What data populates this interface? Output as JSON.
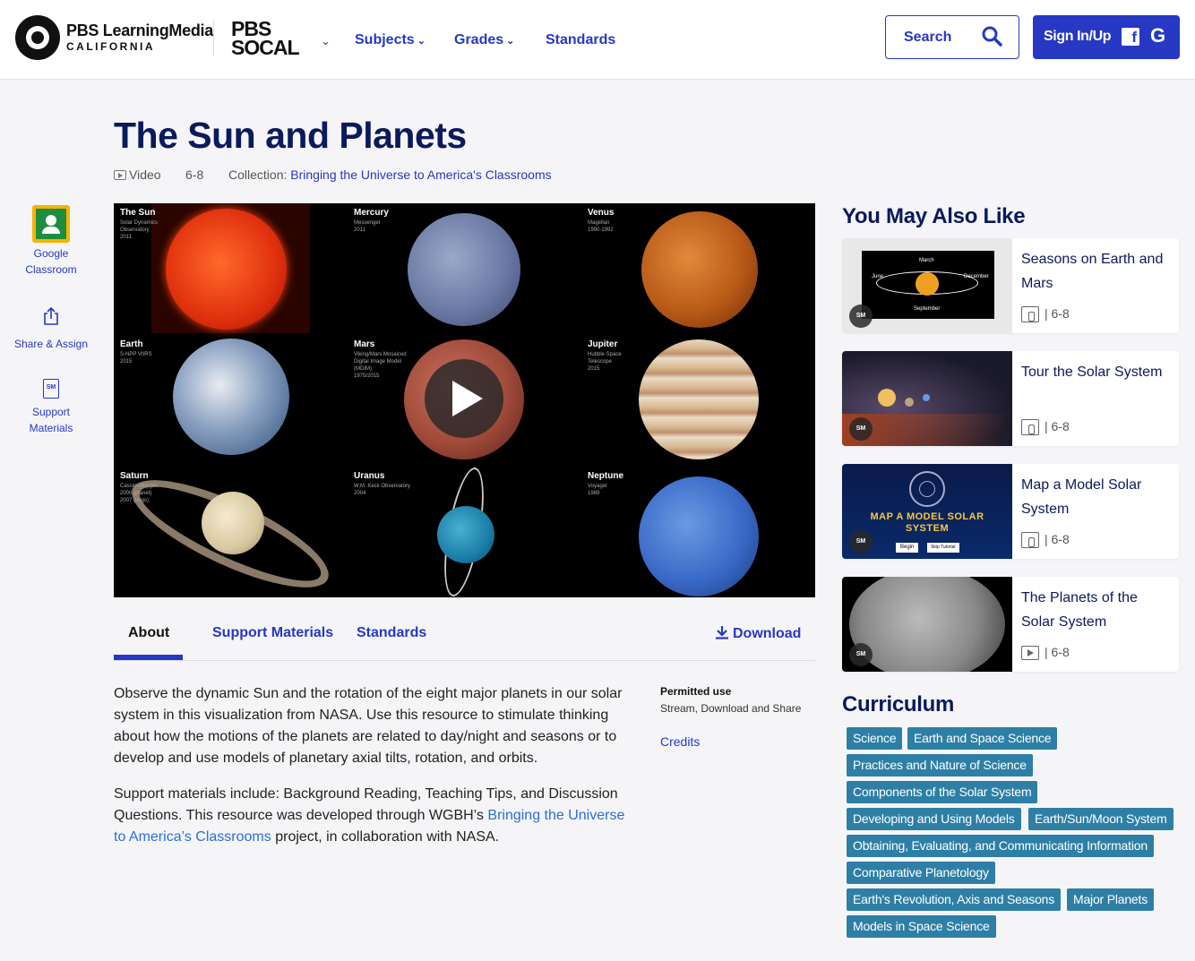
{
  "header": {
    "logo_line1": "PBS LearningMedia",
    "logo_line2": "CALIFORNIA",
    "station": "PBS SOCAL",
    "nav": [
      {
        "label": "Subjects",
        "has_dropdown": true
      },
      {
        "label": "Grades",
        "has_dropdown": true
      },
      {
        "label": "Standards",
        "has_dropdown": false
      }
    ],
    "search_label": "Search",
    "signin_label": "Sign In/Up"
  },
  "page": {
    "title": "The Sun and Planets",
    "media_type": "Video",
    "grades": "6-8",
    "collection_label": "Collection:",
    "collection_name": "Bringing the Universe to America's Classrooms"
  },
  "sidebar": {
    "google_classroom": "Google Classroom",
    "share_assign": "Share & Assign",
    "support_materials": "Support Materials",
    "sm_badge": "SM"
  },
  "video_panels": [
    {
      "name": "The Sun",
      "sub": "Solar Dynamics\nObservatory\n2011"
    },
    {
      "name": "Mercury",
      "sub": "Messenger\n2011"
    },
    {
      "name": "Venus",
      "sub": "Magellan\n1990-1992"
    },
    {
      "name": "Earth",
      "sub": "S-NPP VIIRS\n2015"
    },
    {
      "name": "Mars",
      "sub": "Viking/Mars Mosaiced\nDigital Image Model\n(MDIM)\n1975/2015"
    },
    {
      "name": "Jupiter",
      "sub": "Hubble Space\nTelescope\n2015"
    },
    {
      "name": "Saturn",
      "sub": "Cassini-Huygen\n2000 (planet)\n2007 (rings)"
    },
    {
      "name": "Uranus",
      "sub": "W.M. Keck Observatory\n2004"
    },
    {
      "name": "Neptune",
      "sub": "Voyager\n1989"
    }
  ],
  "tabs": {
    "about": "About",
    "support": "Support Materials",
    "standards": "Standards",
    "download": "Download"
  },
  "about": {
    "p1": "Observe the dynamic Sun and the rotation of the eight major planets in our solar system in this visualization from NASA. Use this resource to stimulate thinking about how the motions of the planets are related to day/night and seasons or to develop and use models of planetary axial tilts, rotation, and orbits.",
    "p2_before": "Support materials include: Background Reading, Teaching Tips, and Discussion Questions. This resource was developed through WGBH’s ",
    "p2_link": "Bringing the Universe to America’s Classrooms",
    "p2_after": " project, in collaboration with NASA.",
    "permitted_heading": "Permitted use",
    "permitted_value": "Stream, Download and Share",
    "credits": "Credits"
  },
  "related": {
    "heading": "You May Also Like",
    "items": [
      {
        "title": "Seasons on Earth and Mars",
        "grades": "6-8",
        "type": "interactive",
        "thumb_labels": [
          "March",
          "June",
          "December",
          "September"
        ]
      },
      {
        "title": "Tour the Solar System",
        "grades": "6-8",
        "type": "interactive"
      },
      {
        "title": "Map a Model Solar System",
        "grades": "6-8",
        "type": "interactive",
        "thumb_title": "MAP A MODEL SOLAR SYSTEM",
        "thumb_begin": "Begin",
        "thumb_skip": "Skip Tutorial"
      },
      {
        "title": "The Planets of the Solar System",
        "grades": "6-8",
        "type": "video"
      }
    ],
    "grade_sep": "|"
  },
  "curriculum": {
    "heading": "Curriculum",
    "tags": [
      "Science",
      "Earth and Space Science",
      "Practices and Nature of Science",
      "Components of the Solar System",
      "Developing and Using Models",
      "Earth/Sun/Moon System",
      "Obtaining, Evaluating, and Communicating Information",
      "Comparative Planetology",
      "Earth's Revolution, Axis and Seasons",
      "Major Planets",
      "Models in Space Science"
    ]
  },
  "colors": {
    "brand": "#2638c4",
    "title": "#0a1a5c",
    "tag": "#2e7fa6"
  }
}
